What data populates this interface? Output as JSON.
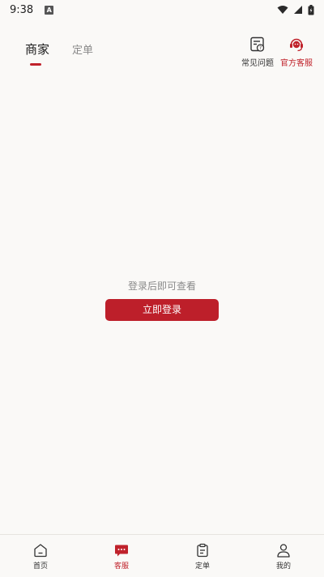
{
  "status_bar": {
    "time": "9:38",
    "notification_icon": "a-icon",
    "wifi_icon": "wifi-icon",
    "signal_icon": "signal-icon",
    "battery_icon": "battery-icon"
  },
  "header": {
    "tabs": [
      {
        "label": "商家",
        "active": true
      },
      {
        "label": "定单",
        "active": false
      }
    ],
    "actions": [
      {
        "label": "常见问题",
        "icon": "faq-icon"
      },
      {
        "label": "官方客服",
        "icon": "customer-service-icon"
      }
    ]
  },
  "main": {
    "empty_message": "登录后即可查看",
    "login_button": "立即登录"
  },
  "bottom_nav": {
    "items": [
      {
        "label": "首页",
        "icon": "home-icon",
        "active": false
      },
      {
        "label": "客服",
        "icon": "chat-icon",
        "active": true
      },
      {
        "label": "定单",
        "icon": "order-icon",
        "active": false
      },
      {
        "label": "我的",
        "icon": "profile-icon",
        "active": false
      }
    ]
  },
  "colors": {
    "accent": "#c0222b",
    "background": "#faf9f7",
    "text_muted": "#8a8a8a"
  }
}
